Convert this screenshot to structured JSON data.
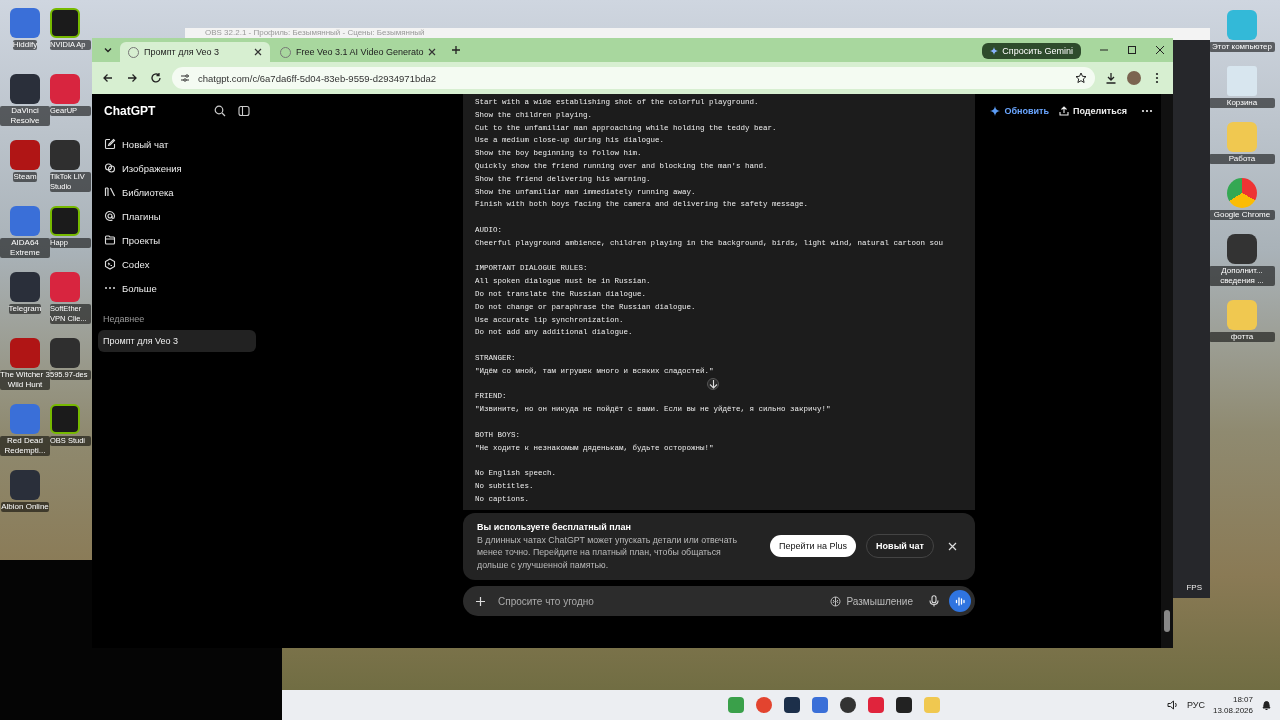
{
  "desktop": {
    "left_icons": [
      {
        "label": "Hiddify"
      },
      {
        "label": "NVIDIA Ap"
      },
      {
        "label": "DaVinci Resolve"
      },
      {
        "label": "GearUP"
      },
      {
        "label": "Steam"
      },
      {
        "label": "TikTok LIV Studio"
      },
      {
        "label": "AIDA64 Extreme"
      },
      {
        "label": "Happ"
      },
      {
        "label": "Telegram"
      },
      {
        "label": "SoftEther VPN Clie..."
      },
      {
        "label": "The Witcher 3 Wild Hunt"
      },
      {
        "label": "595.97-des"
      },
      {
        "label": "Red Dead Redempti..."
      },
      {
        "label": "OBS Studi"
      },
      {
        "label": "Albion Online"
      }
    ],
    "right_icons": [
      {
        "label": "Этот компьютер"
      },
      {
        "label": "Корзина"
      },
      {
        "label": "Работа"
      },
      {
        "label": "Google Chrome"
      },
      {
        "label": "Дополнит... сведения ..."
      },
      {
        "label": "фотта"
      }
    ]
  },
  "obs_window": {
    "title": "OBS 32.2.1 - Профиль: Безымянный - Сцены: Безымянный",
    "status": "FPS"
  },
  "browser": {
    "tabs": [
      {
        "label": "Промпт для Veo 3",
        "selected": true
      },
      {
        "label": "Free Veo 3.1 AI Video Generato",
        "selected": false
      }
    ],
    "gemini_button": "Спросить Gemini",
    "url": "chatgpt.com/c/6a7da6ff-5d04-83eb-9559-d2934971bda2"
  },
  "chatgpt": {
    "title": "ChatGPT",
    "nav": [
      {
        "label": "Новый чат",
        "kind": "new-chat"
      },
      {
        "label": "Изображения",
        "kind": "images"
      },
      {
        "label": "Библиотека",
        "kind": "library"
      },
      {
        "label": "Плагины",
        "kind": "plugins"
      },
      {
        "label": "Проекты",
        "kind": "projects"
      },
      {
        "label": "Codex",
        "kind": "codex"
      },
      {
        "label": "Больше",
        "kind": "more"
      }
    ],
    "recent_heading": "Недавнее",
    "chats": [
      {
        "label": "Промпт для Veo 3",
        "selected": true
      }
    ],
    "header_actions": [
      {
        "label": "Обновить",
        "kind": "upgrade"
      },
      {
        "label": "Поделиться",
        "kind": "share"
      }
    ],
    "code_paragraphs": [
      [
        "Start with a wide establishing shot of the colorful playground.",
        "Show the children playing.",
        "Cut to the unfamiliar man approaching while holding the teddy bear.",
        "Use a medium close-up during his dialogue.",
        "Show the boy beginning to follow him.",
        "Quickly show the friend running over and blocking the man's hand.",
        "Show the friend delivering his warning.",
        "Show the unfamiliar man immediately running away.",
        "Finish with both boys facing the camera and delivering the safety message."
      ],
      [
        "AUDIO:",
        "Cheerful playground ambience, children playing in the background, birds, light wind, natural cartoon sou"
      ],
      [
        "IMPORTANT DIALOGUE RULES:",
        "All spoken dialogue must be in Russian.",
        "Do not translate the Russian dialogue.",
        "Do not change or paraphrase the Russian dialogue.",
        "Use accurate lip synchronization.",
        "Do not add any additional dialogue."
      ],
      [
        "STRANGER:",
        "\"Идём со мной, там игрушек много и всяких сладостей.\""
      ],
      [
        "FRIEND:",
        "\"Извините, но он никуда не пойдёт с вами. Если вы не уйдёте, я сильно закричу!\""
      ],
      [
        "BOTH BOYS:",
        "\"Не ходите к незнакомым дяденькам, будьте осторожны!\""
      ],
      [
        "No English speech.",
        "No subtitles.",
        "No captions."
      ]
    ],
    "banner": {
      "title": "Вы используете бесплатный план",
      "text": "В длинных чатах ChatGPT может упускать детали или отвечать менее точно. Перейдите на платный план, чтобы общаться дольше с улучшенной памятью.",
      "primary_button": "Перейти на Plus",
      "secondary_button": "Новый чат"
    },
    "composer": {
      "placeholder": "Спросите что угодно",
      "mode": "Размышление"
    }
  },
  "taskbar": {
    "language": "РУС",
    "time": "18:07",
    "date": "13.08.2026"
  }
}
